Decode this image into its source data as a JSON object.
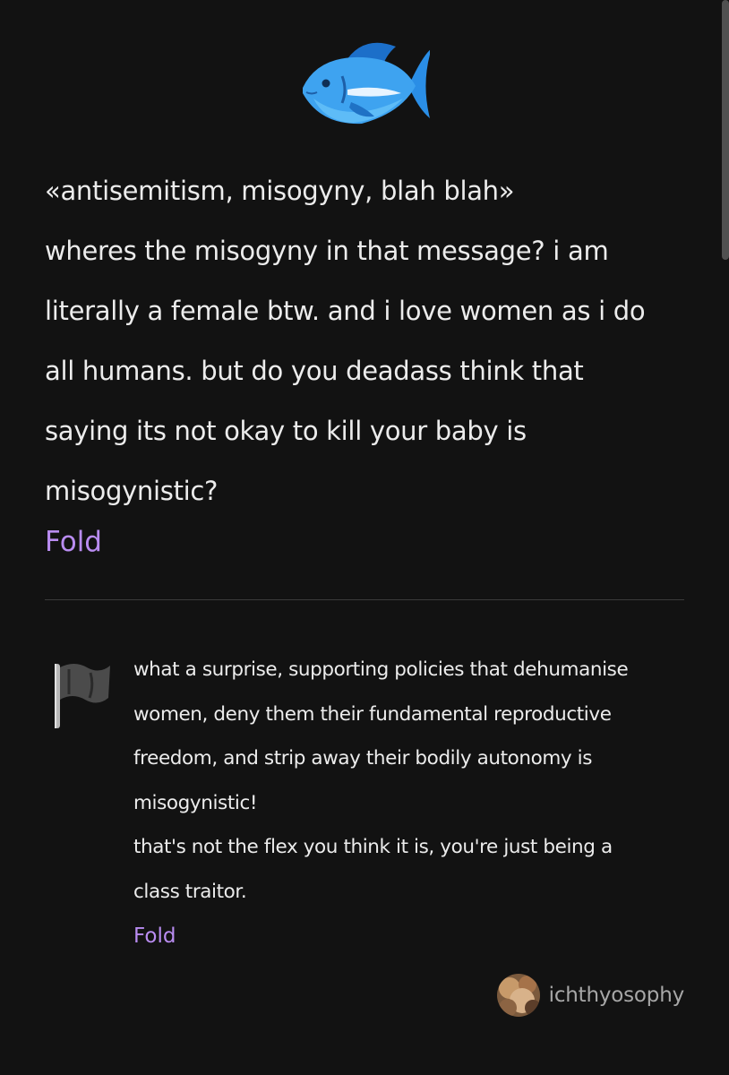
{
  "question": {
    "lines": [
      "«antisemitism, misogyny, blah blah»",
      "wheres the misogyny in that message? i am",
      "literally a female btw. and i love women as i do",
      "all humans. but do you deadass think that",
      "saying its not okay to kill your baby is",
      "misogynistic?"
    ],
    "fold_label": "Fold"
  },
  "answer": {
    "lines": [
      "what a surprise, supporting policies that dehumanise",
      "women, deny them their fundamental reproductive",
      "freedom, and strip away their bodily autonomy is",
      "misogynistic!",
      "that's not the flex you think it is, you're just being a",
      "class traitor."
    ],
    "fold_label": "Fold"
  },
  "author": {
    "name": "ichthyosophy"
  },
  "icons": {
    "header": "fish-icon",
    "answer_marker": "black-flag-icon"
  },
  "colors": {
    "background": "#121212",
    "text": "#ececec",
    "link": "#b98cf1",
    "muted": "#a7a7a7",
    "divider": "#3a3a3a"
  }
}
